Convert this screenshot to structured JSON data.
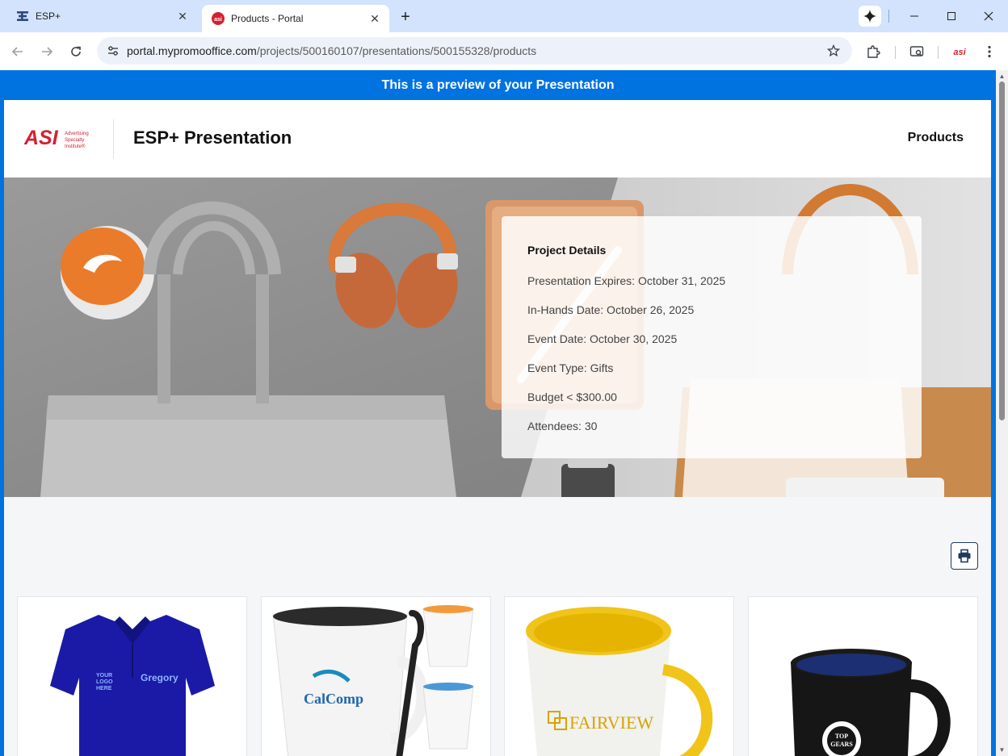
{
  "browser": {
    "tabs": [
      {
        "title": "ESP+",
        "active": false
      },
      {
        "title": "Products - Portal",
        "active": true
      }
    ],
    "url_domain": "portal.mypromooffice.com",
    "url_path": "/projects/500160107/presentations/500155328/products"
  },
  "banner": {
    "text": "This is a preview of your Presentation"
  },
  "header": {
    "logo_text": "ASI",
    "logo_tagline": [
      "Advertising",
      "Specialty",
      "Institute®"
    ],
    "title": "ESP+ Presentation",
    "nav_products": "Products"
  },
  "project_details": {
    "heading": "Project Details",
    "lines": [
      "Presentation Expires: October 31, 2025",
      "In-Hands Date: October 26, 2025",
      "Event Date: October 30, 2025",
      "Event Type: Gifts",
      "Budget < $300.00",
      "Attendees: 30"
    ]
  },
  "products": [
    {
      "print": [
        "YOUR",
        "LOGO",
        "HERE",
        "Gregory"
      ]
    },
    {
      "print": [
        "CalComp"
      ]
    },
    {
      "print": [
        "FAIRVIEW"
      ]
    },
    {
      "print": [
        "TOP",
        "GEARS"
      ]
    }
  ],
  "colors": {
    "banner_blue": "#0073e0",
    "asi_red": "#d4202f",
    "tab_strip": "#d3e3fd"
  }
}
